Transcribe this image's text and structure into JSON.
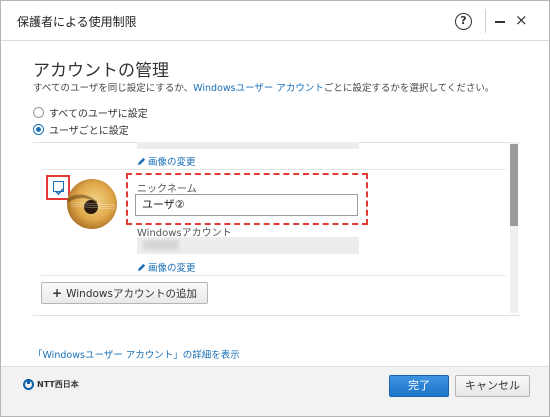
{
  "window": {
    "title": "保護者による使用制限",
    "help_icon": "?",
    "minimize_icon": "–",
    "close_icon": "×"
  },
  "heading": "アカウントの管理",
  "description": {
    "prefix": "すべてのユーザを同じ設定にするか、",
    "link": "Windowsユーザー アカウント",
    "suffix": "ごとに設定するかを選択してください。"
  },
  "radios": [
    {
      "label": "すべてのユーザに設定",
      "checked": false
    },
    {
      "label": "ユーザごとに設定",
      "checked": true
    }
  ],
  "user": {
    "checked": true,
    "change_image_label": "画像の変更",
    "nickname_label": "ニックネーム",
    "nickname_value": "ユーザ②",
    "account_label": "Windowsアカウント",
    "prev_change_image_label": "画像の変更"
  },
  "add_button": "Windowsアカウントの追加",
  "detail_link": "「Windowsユーザー アカウント」の詳細を表示",
  "footer": {
    "logo_text": "NTT西日本",
    "ok": "完了",
    "cancel": "キャンセル"
  },
  "colors": {
    "accent": "#1a6fb7",
    "highlight": "#e53935"
  }
}
